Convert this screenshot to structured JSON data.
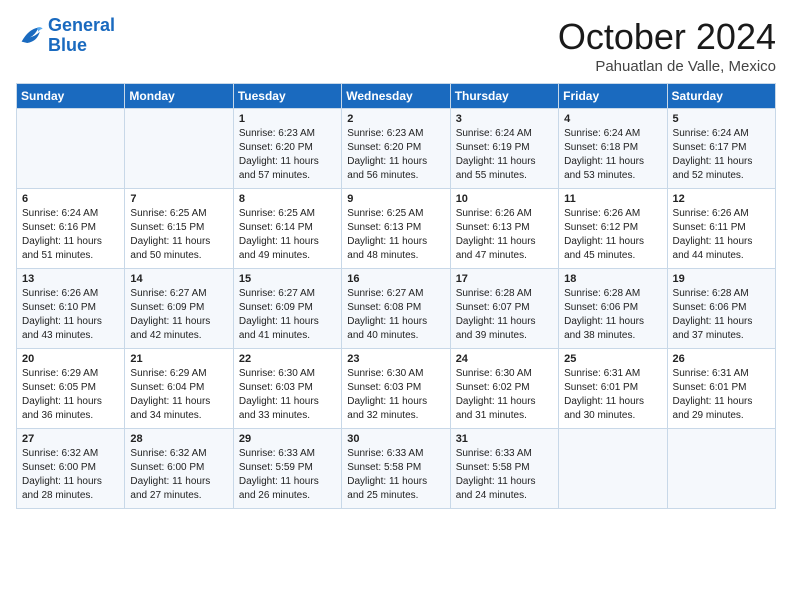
{
  "header": {
    "logo_line1": "General",
    "logo_line2": "Blue",
    "month": "October 2024",
    "location": "Pahuatlan de Valle, Mexico"
  },
  "days_of_week": [
    "Sunday",
    "Monday",
    "Tuesday",
    "Wednesday",
    "Thursday",
    "Friday",
    "Saturday"
  ],
  "weeks": [
    [
      {
        "day": "",
        "info": ""
      },
      {
        "day": "",
        "info": ""
      },
      {
        "day": "1",
        "info": "Sunrise: 6:23 AM\nSunset: 6:20 PM\nDaylight: 11 hours\nand 57 minutes."
      },
      {
        "day": "2",
        "info": "Sunrise: 6:23 AM\nSunset: 6:20 PM\nDaylight: 11 hours\nand 56 minutes."
      },
      {
        "day": "3",
        "info": "Sunrise: 6:24 AM\nSunset: 6:19 PM\nDaylight: 11 hours\nand 55 minutes."
      },
      {
        "day": "4",
        "info": "Sunrise: 6:24 AM\nSunset: 6:18 PM\nDaylight: 11 hours\nand 53 minutes."
      },
      {
        "day": "5",
        "info": "Sunrise: 6:24 AM\nSunset: 6:17 PM\nDaylight: 11 hours\nand 52 minutes."
      }
    ],
    [
      {
        "day": "6",
        "info": "Sunrise: 6:24 AM\nSunset: 6:16 PM\nDaylight: 11 hours\nand 51 minutes."
      },
      {
        "day": "7",
        "info": "Sunrise: 6:25 AM\nSunset: 6:15 PM\nDaylight: 11 hours\nand 50 minutes."
      },
      {
        "day": "8",
        "info": "Sunrise: 6:25 AM\nSunset: 6:14 PM\nDaylight: 11 hours\nand 49 minutes."
      },
      {
        "day": "9",
        "info": "Sunrise: 6:25 AM\nSunset: 6:13 PM\nDaylight: 11 hours\nand 48 minutes."
      },
      {
        "day": "10",
        "info": "Sunrise: 6:26 AM\nSunset: 6:13 PM\nDaylight: 11 hours\nand 47 minutes."
      },
      {
        "day": "11",
        "info": "Sunrise: 6:26 AM\nSunset: 6:12 PM\nDaylight: 11 hours\nand 45 minutes."
      },
      {
        "day": "12",
        "info": "Sunrise: 6:26 AM\nSunset: 6:11 PM\nDaylight: 11 hours\nand 44 minutes."
      }
    ],
    [
      {
        "day": "13",
        "info": "Sunrise: 6:26 AM\nSunset: 6:10 PM\nDaylight: 11 hours\nand 43 minutes."
      },
      {
        "day": "14",
        "info": "Sunrise: 6:27 AM\nSunset: 6:09 PM\nDaylight: 11 hours\nand 42 minutes."
      },
      {
        "day": "15",
        "info": "Sunrise: 6:27 AM\nSunset: 6:09 PM\nDaylight: 11 hours\nand 41 minutes."
      },
      {
        "day": "16",
        "info": "Sunrise: 6:27 AM\nSunset: 6:08 PM\nDaylight: 11 hours\nand 40 minutes."
      },
      {
        "day": "17",
        "info": "Sunrise: 6:28 AM\nSunset: 6:07 PM\nDaylight: 11 hours\nand 39 minutes."
      },
      {
        "day": "18",
        "info": "Sunrise: 6:28 AM\nSunset: 6:06 PM\nDaylight: 11 hours\nand 38 minutes."
      },
      {
        "day": "19",
        "info": "Sunrise: 6:28 AM\nSunset: 6:06 PM\nDaylight: 11 hours\nand 37 minutes."
      }
    ],
    [
      {
        "day": "20",
        "info": "Sunrise: 6:29 AM\nSunset: 6:05 PM\nDaylight: 11 hours\nand 36 minutes."
      },
      {
        "day": "21",
        "info": "Sunrise: 6:29 AM\nSunset: 6:04 PM\nDaylight: 11 hours\nand 34 minutes."
      },
      {
        "day": "22",
        "info": "Sunrise: 6:30 AM\nSunset: 6:03 PM\nDaylight: 11 hours\nand 33 minutes."
      },
      {
        "day": "23",
        "info": "Sunrise: 6:30 AM\nSunset: 6:03 PM\nDaylight: 11 hours\nand 32 minutes."
      },
      {
        "day": "24",
        "info": "Sunrise: 6:30 AM\nSunset: 6:02 PM\nDaylight: 11 hours\nand 31 minutes."
      },
      {
        "day": "25",
        "info": "Sunrise: 6:31 AM\nSunset: 6:01 PM\nDaylight: 11 hours\nand 30 minutes."
      },
      {
        "day": "26",
        "info": "Sunrise: 6:31 AM\nSunset: 6:01 PM\nDaylight: 11 hours\nand 29 minutes."
      }
    ],
    [
      {
        "day": "27",
        "info": "Sunrise: 6:32 AM\nSunset: 6:00 PM\nDaylight: 11 hours\nand 28 minutes."
      },
      {
        "day": "28",
        "info": "Sunrise: 6:32 AM\nSunset: 6:00 PM\nDaylight: 11 hours\nand 27 minutes."
      },
      {
        "day": "29",
        "info": "Sunrise: 6:33 AM\nSunset: 5:59 PM\nDaylight: 11 hours\nand 26 minutes."
      },
      {
        "day": "30",
        "info": "Sunrise: 6:33 AM\nSunset: 5:58 PM\nDaylight: 11 hours\nand 25 minutes."
      },
      {
        "day": "31",
        "info": "Sunrise: 6:33 AM\nSunset: 5:58 PM\nDaylight: 11 hours\nand 24 minutes."
      },
      {
        "day": "",
        "info": ""
      },
      {
        "day": "",
        "info": ""
      }
    ]
  ]
}
